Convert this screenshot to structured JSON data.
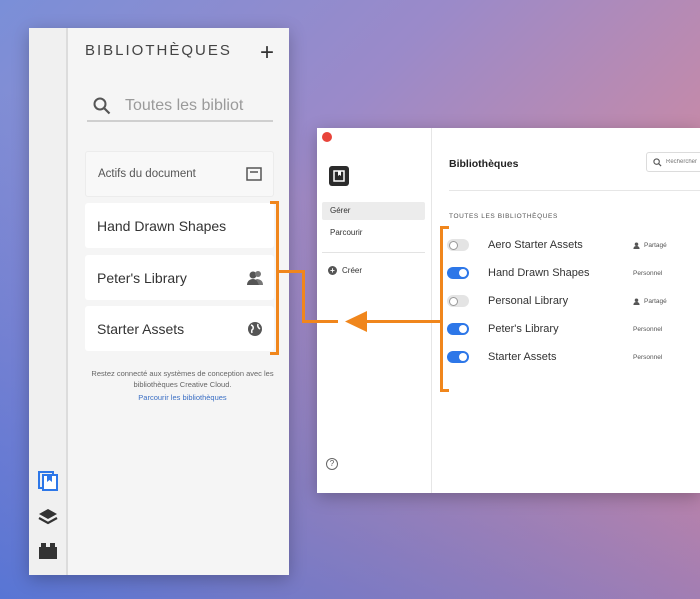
{
  "left_panel": {
    "title": "BIBLIOTHÈQUES",
    "add_label": "+",
    "search_placeholder": "Toutes les bibliot",
    "document_assets": "Actifs du document",
    "libraries": [
      {
        "name": "Hand Drawn Shapes",
        "icon": ""
      },
      {
        "name": "Peter's Library",
        "icon": "shared-user-icon"
      },
      {
        "name": "Starter Assets",
        "icon": "globe-icon"
      }
    ],
    "stay_connected": "Restez connecté aux systèmes de conception avec les bibliothèques Creative Cloud.",
    "browse_link": "Parcourir les bibliothèques",
    "rail_icons": [
      "libraries-icon",
      "layers-icon",
      "plugins-icon"
    ]
  },
  "window": {
    "title": "Bibliothèques",
    "search_placeholder": "Rechercher",
    "nav": {
      "manage": "Gérer",
      "browse": "Parcourir",
      "create": "Créer"
    },
    "section_label": "TOUTES LES BIBLIOTHÈQUES",
    "libraries": [
      {
        "name": "Aero Starter Assets",
        "enabled": false,
        "status": "Partagé"
      },
      {
        "name": "Hand Drawn Shapes",
        "enabled": true,
        "status": "Personnel"
      },
      {
        "name": "Personal Library",
        "enabled": false,
        "status": "Partagé"
      },
      {
        "name": "Peter's Library",
        "enabled": true,
        "status": "Personnel"
      },
      {
        "name": "Starter Assets",
        "enabled": true,
        "status": "Personnel"
      }
    ],
    "help": "?"
  },
  "colors": {
    "accent_blue": "#2d77e8",
    "annotation_orange": "#f0861c",
    "close_red": "#e8443a",
    "link_blue": "#3b6fc4"
  }
}
